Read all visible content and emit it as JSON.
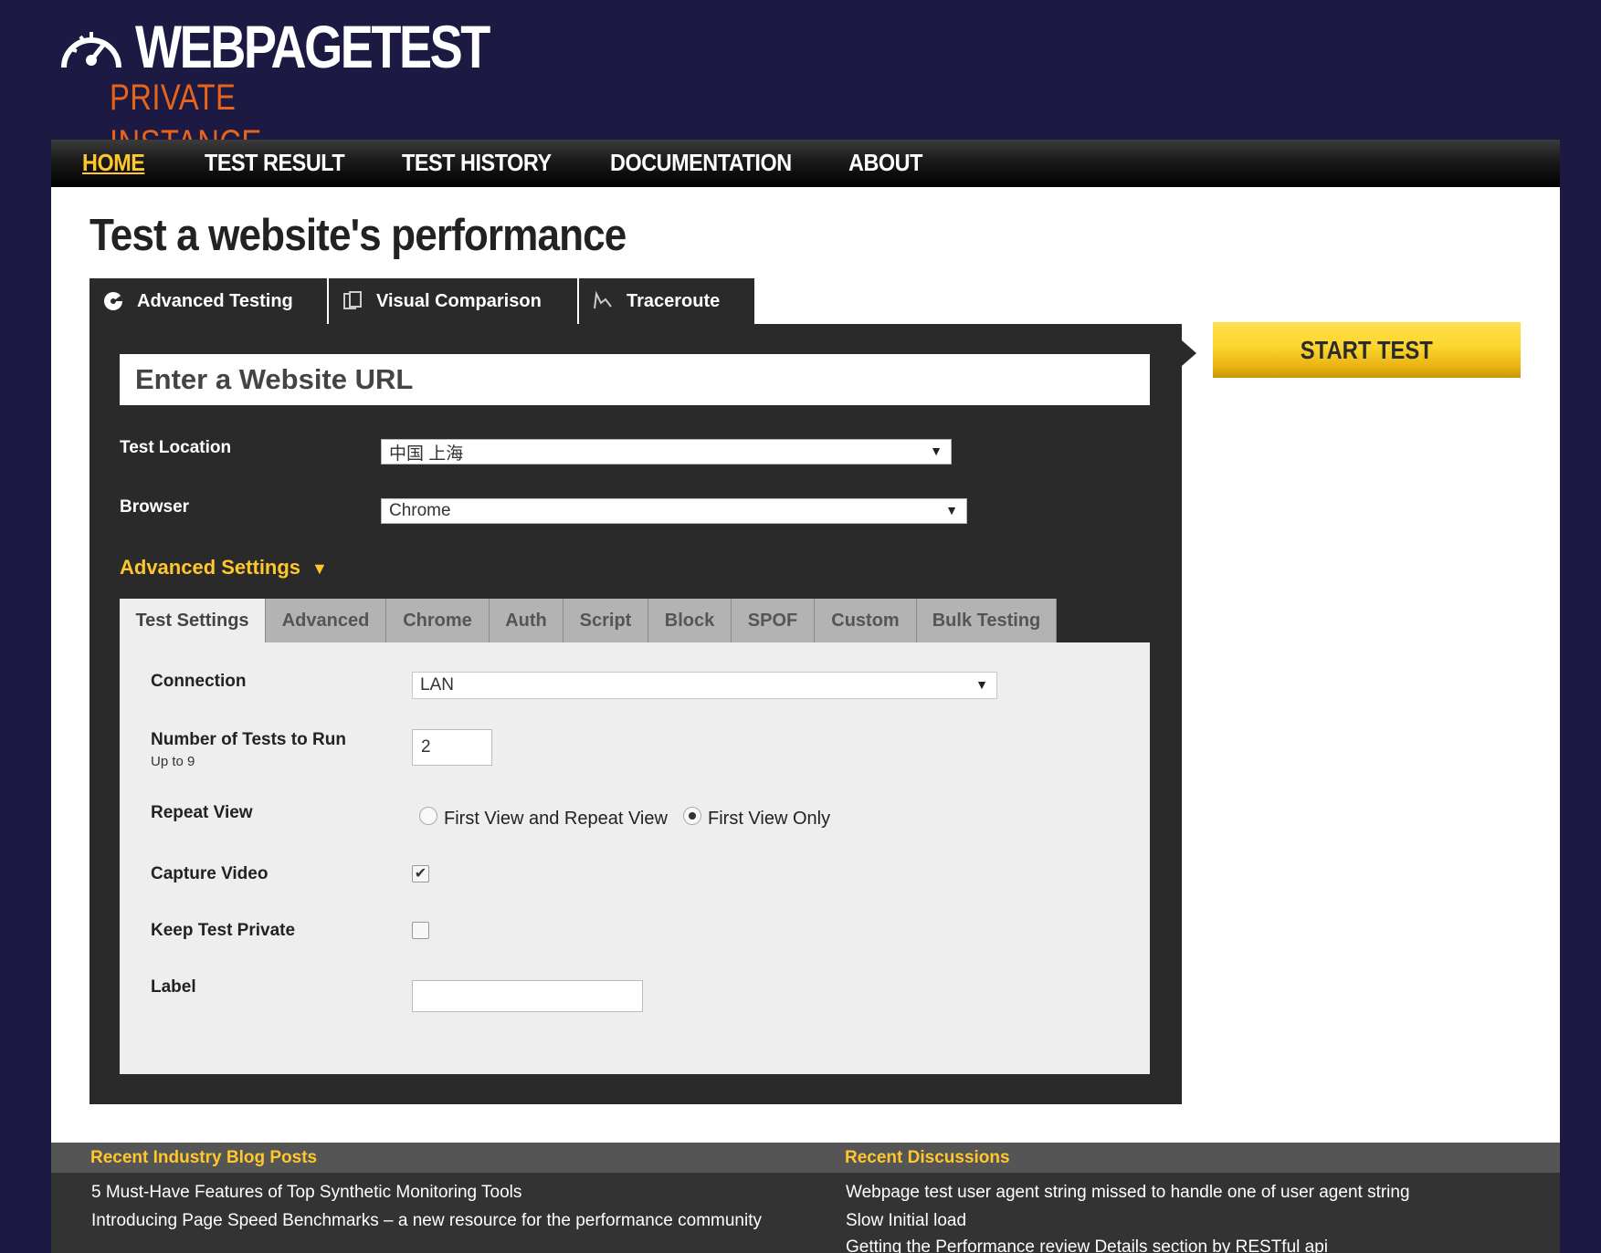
{
  "logo": {
    "title": "WEBPAGETEST",
    "subtitle": "PRIVATE INSTANCE"
  },
  "nav": [
    {
      "label": "HOME",
      "active": true
    },
    {
      "label": "TEST RESULT",
      "active": false
    },
    {
      "label": "TEST HISTORY",
      "active": false
    },
    {
      "label": "DOCUMENTATION",
      "active": false
    },
    {
      "label": "ABOUT",
      "active": false
    }
  ],
  "page_title": "Test a website's performance",
  "test_tabs": [
    {
      "label": "Advanced Testing",
      "icon": "gauge-icon",
      "active": true
    },
    {
      "label": "Visual Comparison",
      "icon": "compare-icon",
      "active": false
    },
    {
      "label": "Traceroute",
      "icon": "traceroute-icon",
      "active": false
    }
  ],
  "url_input": {
    "placeholder": "Enter a Website URL",
    "value": ""
  },
  "test_location": {
    "label": "Test Location",
    "value": "中国 上海"
  },
  "browser": {
    "label": "Browser",
    "value": "Chrome"
  },
  "advanced_settings": {
    "label": "Advanced Settings",
    "expanded": true
  },
  "settings_tabs": [
    "Test Settings",
    "Advanced",
    "Chrome",
    "Auth",
    "Script",
    "Block",
    "SPOF",
    "Custom",
    "Bulk Testing"
  ],
  "settings": {
    "connection": {
      "label": "Connection",
      "value": "LAN"
    },
    "num_tests": {
      "label": "Number of Tests to Run",
      "hint": "Up to 9",
      "value": "2"
    },
    "repeat_view": {
      "label": "Repeat View",
      "options": [
        "First View and Repeat View",
        "First View Only"
      ],
      "selected": "First View Only"
    },
    "capture_video": {
      "label": "Capture Video",
      "checked": true
    },
    "keep_private": {
      "label": "Keep Test Private",
      "checked": false
    },
    "label_field": {
      "label": "Label",
      "value": ""
    }
  },
  "start_button": "START TEST",
  "footer": {
    "blog": {
      "heading": "Recent Industry Blog Posts",
      "items": [
        "5 Must-Have Features of Top Synthetic Monitoring Tools",
        "Introducing Page Speed Benchmarks – a new resource for the performance community"
      ]
    },
    "discussions": {
      "heading": "Recent Discussions",
      "items": [
        "Webpage test user agent string missed to handle one of user agent string",
        "Slow Initial load",
        "Getting the Performance review Details section by RESTful api"
      ]
    }
  },
  "colors": {
    "accent": "#ffc72c",
    "background": "#1c1942",
    "panel": "#2a2a2a",
    "logo_orange": "#e8641a"
  }
}
